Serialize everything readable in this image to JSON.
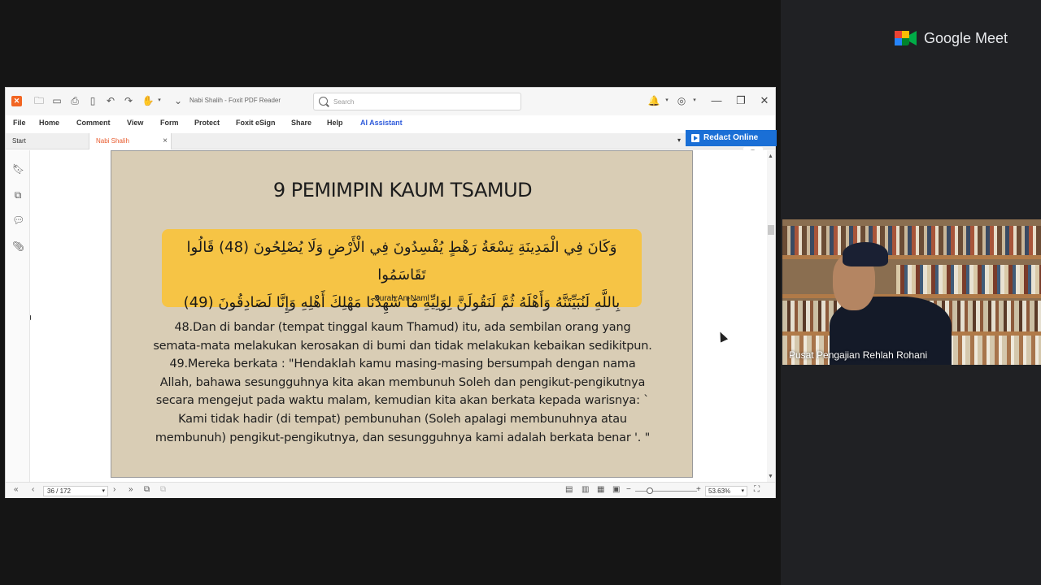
{
  "meet": {
    "brand": "Google Meet",
    "participant_name": "Pusat Pengajian Rehlah Rohani"
  },
  "app": {
    "title": "Nabi Shalih - Foxit PDF Reader",
    "search_placeholder": "Search"
  },
  "menu": [
    "File",
    "Home",
    "Comment",
    "View",
    "Form",
    "Protect",
    "Foxit eSign",
    "Share",
    "Help",
    "AI Assistant"
  ],
  "tabs": {
    "start": "Start",
    "active": "Nabi Shalih",
    "close": "×"
  },
  "redact_label": "Redact Online",
  "document": {
    "heading": "9 PEMIMPIN KAUM TSAMUD",
    "arabic_line1": "وَكَانَ فِي الْمَدِينَةِ تِسْعَةُ رَهْطٍ يُفْسِدُونَ فِي الْأَرْضِ وَلَا يُصْلِحُونَ (48) قَالُوا تَقَاسَمُوا",
    "arabic_line2": "بِاللَّهِ لَنُبَيِّتَنَّهُ وَأَهْلَهُ ثُمَّ لَنَقُولَنَّ لِوَلِيِّهِ مَا شَهِدْنَا مَهْلِكَ أَهْلِهِ وَإِنَّا لَصَادِقُونَ (49)",
    "surah": "Surah An-Naml",
    "translation_1": "48.Dan di bandar (tempat tinggal kaum Thamud) itu, ada sembilan orang yang",
    "translation_2": "semata-mata melakukan kerosakan di bumi dan tidak melakukan kebaikan sedikitpun.",
    "translation_3": "49.Mereka berkata : \"Hendaklah kamu masing-masing bersumpah dengan nama",
    "translation_4": "Allah, bahawa sesungguhnya kita akan membunuh Soleh dan pengikut-pengikutnya",
    "translation_5": "secara mengejut pada waktu malam, kemudian kita akan berkata kepada warisnya: `",
    "translation_6": "Kami tidak hadir (di tempat) pembunuhan (Soleh apalagi membunuhnya atau",
    "translation_7": "membunuh) pengikut-pengikutnya, dan sesungguhnya kami adalah berkata benar '. \""
  },
  "status": {
    "page": "36 / 172",
    "zoom": "53.63%"
  },
  "colors": {
    "accent": "#1a6fd6",
    "verse_bg": "#f6c445",
    "page_bg": "#d9cdb5",
    "tab_active": "#e85a2c"
  },
  "icons": {
    "bell": "🔔",
    "user": "◎",
    "headset": "🎧"
  }
}
